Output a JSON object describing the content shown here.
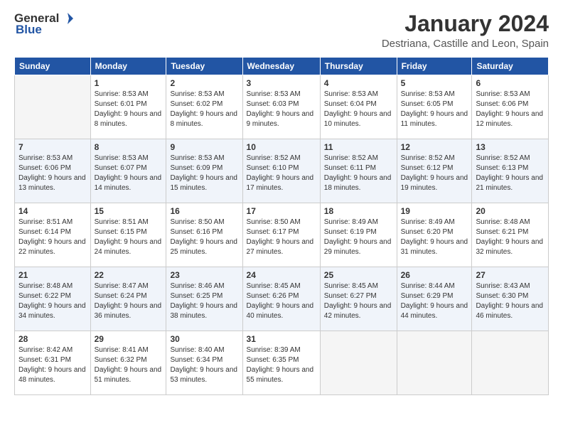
{
  "logo": {
    "general": "General",
    "blue": "Blue"
  },
  "header": {
    "month": "January 2024",
    "location": "Destriana, Castille and Leon, Spain"
  },
  "weekdays": [
    "Sunday",
    "Monday",
    "Tuesday",
    "Wednesday",
    "Thursday",
    "Friday",
    "Saturday"
  ],
  "weeks": [
    [
      {
        "day": "",
        "sunrise": "",
        "sunset": "",
        "daylight": ""
      },
      {
        "day": "1",
        "sunrise": "Sunrise: 8:53 AM",
        "sunset": "Sunset: 6:01 PM",
        "daylight": "Daylight: 9 hours and 8 minutes."
      },
      {
        "day": "2",
        "sunrise": "Sunrise: 8:53 AM",
        "sunset": "Sunset: 6:02 PM",
        "daylight": "Daylight: 9 hours and 8 minutes."
      },
      {
        "day": "3",
        "sunrise": "Sunrise: 8:53 AM",
        "sunset": "Sunset: 6:03 PM",
        "daylight": "Daylight: 9 hours and 9 minutes."
      },
      {
        "day": "4",
        "sunrise": "Sunrise: 8:53 AM",
        "sunset": "Sunset: 6:04 PM",
        "daylight": "Daylight: 9 hours and 10 minutes."
      },
      {
        "day": "5",
        "sunrise": "Sunrise: 8:53 AM",
        "sunset": "Sunset: 6:05 PM",
        "daylight": "Daylight: 9 hours and 11 minutes."
      },
      {
        "day": "6",
        "sunrise": "Sunrise: 8:53 AM",
        "sunset": "Sunset: 6:06 PM",
        "daylight": "Daylight: 9 hours and 12 minutes."
      }
    ],
    [
      {
        "day": "7",
        "sunrise": "Sunrise: 8:53 AM",
        "sunset": "Sunset: 6:06 PM",
        "daylight": "Daylight: 9 hours and 13 minutes."
      },
      {
        "day": "8",
        "sunrise": "Sunrise: 8:53 AM",
        "sunset": "Sunset: 6:07 PM",
        "daylight": "Daylight: 9 hours and 14 minutes."
      },
      {
        "day": "9",
        "sunrise": "Sunrise: 8:53 AM",
        "sunset": "Sunset: 6:09 PM",
        "daylight": "Daylight: 9 hours and 15 minutes."
      },
      {
        "day": "10",
        "sunrise": "Sunrise: 8:52 AM",
        "sunset": "Sunset: 6:10 PM",
        "daylight": "Daylight: 9 hours and 17 minutes."
      },
      {
        "day": "11",
        "sunrise": "Sunrise: 8:52 AM",
        "sunset": "Sunset: 6:11 PM",
        "daylight": "Daylight: 9 hours and 18 minutes."
      },
      {
        "day": "12",
        "sunrise": "Sunrise: 8:52 AM",
        "sunset": "Sunset: 6:12 PM",
        "daylight": "Daylight: 9 hours and 19 minutes."
      },
      {
        "day": "13",
        "sunrise": "Sunrise: 8:52 AM",
        "sunset": "Sunset: 6:13 PM",
        "daylight": "Daylight: 9 hours and 21 minutes."
      }
    ],
    [
      {
        "day": "14",
        "sunrise": "Sunrise: 8:51 AM",
        "sunset": "Sunset: 6:14 PM",
        "daylight": "Daylight: 9 hours and 22 minutes."
      },
      {
        "day": "15",
        "sunrise": "Sunrise: 8:51 AM",
        "sunset": "Sunset: 6:15 PM",
        "daylight": "Daylight: 9 hours and 24 minutes."
      },
      {
        "day": "16",
        "sunrise": "Sunrise: 8:50 AM",
        "sunset": "Sunset: 6:16 PM",
        "daylight": "Daylight: 9 hours and 25 minutes."
      },
      {
        "day": "17",
        "sunrise": "Sunrise: 8:50 AM",
        "sunset": "Sunset: 6:17 PM",
        "daylight": "Daylight: 9 hours and 27 minutes."
      },
      {
        "day": "18",
        "sunrise": "Sunrise: 8:49 AM",
        "sunset": "Sunset: 6:19 PM",
        "daylight": "Daylight: 9 hours and 29 minutes."
      },
      {
        "day": "19",
        "sunrise": "Sunrise: 8:49 AM",
        "sunset": "Sunset: 6:20 PM",
        "daylight": "Daylight: 9 hours and 31 minutes."
      },
      {
        "day": "20",
        "sunrise": "Sunrise: 8:48 AM",
        "sunset": "Sunset: 6:21 PM",
        "daylight": "Daylight: 9 hours and 32 minutes."
      }
    ],
    [
      {
        "day": "21",
        "sunrise": "Sunrise: 8:48 AM",
        "sunset": "Sunset: 6:22 PM",
        "daylight": "Daylight: 9 hours and 34 minutes."
      },
      {
        "day": "22",
        "sunrise": "Sunrise: 8:47 AM",
        "sunset": "Sunset: 6:24 PM",
        "daylight": "Daylight: 9 hours and 36 minutes."
      },
      {
        "day": "23",
        "sunrise": "Sunrise: 8:46 AM",
        "sunset": "Sunset: 6:25 PM",
        "daylight": "Daylight: 9 hours and 38 minutes."
      },
      {
        "day": "24",
        "sunrise": "Sunrise: 8:45 AM",
        "sunset": "Sunset: 6:26 PM",
        "daylight": "Daylight: 9 hours and 40 minutes."
      },
      {
        "day": "25",
        "sunrise": "Sunrise: 8:45 AM",
        "sunset": "Sunset: 6:27 PM",
        "daylight": "Daylight: 9 hours and 42 minutes."
      },
      {
        "day": "26",
        "sunrise": "Sunrise: 8:44 AM",
        "sunset": "Sunset: 6:29 PM",
        "daylight": "Daylight: 9 hours and 44 minutes."
      },
      {
        "day": "27",
        "sunrise": "Sunrise: 8:43 AM",
        "sunset": "Sunset: 6:30 PM",
        "daylight": "Daylight: 9 hours and 46 minutes."
      }
    ],
    [
      {
        "day": "28",
        "sunrise": "Sunrise: 8:42 AM",
        "sunset": "Sunset: 6:31 PM",
        "daylight": "Daylight: 9 hours and 48 minutes."
      },
      {
        "day": "29",
        "sunrise": "Sunrise: 8:41 AM",
        "sunset": "Sunset: 6:32 PM",
        "daylight": "Daylight: 9 hours and 51 minutes."
      },
      {
        "day": "30",
        "sunrise": "Sunrise: 8:40 AM",
        "sunset": "Sunset: 6:34 PM",
        "daylight": "Daylight: 9 hours and 53 minutes."
      },
      {
        "day": "31",
        "sunrise": "Sunrise: 8:39 AM",
        "sunset": "Sunset: 6:35 PM",
        "daylight": "Daylight: 9 hours and 55 minutes."
      },
      {
        "day": "",
        "sunrise": "",
        "sunset": "",
        "daylight": ""
      },
      {
        "day": "",
        "sunrise": "",
        "sunset": "",
        "daylight": ""
      },
      {
        "day": "",
        "sunrise": "",
        "sunset": "",
        "daylight": ""
      }
    ]
  ]
}
